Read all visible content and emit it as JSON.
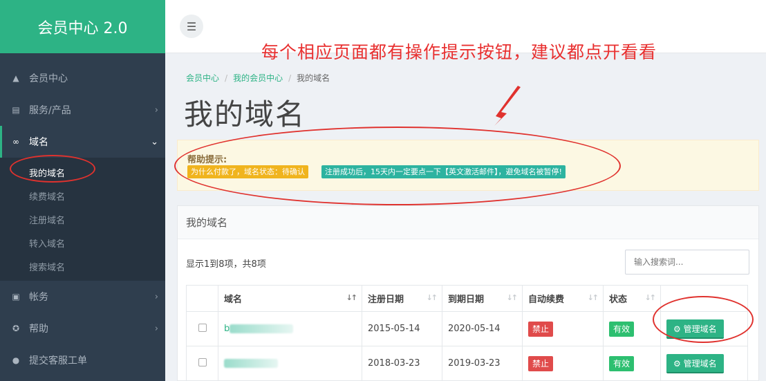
{
  "brand": "会员中心 2.0",
  "annotation": "每个相应页面都有操作提示按钮，建议都点开看看",
  "nav": {
    "items": [
      {
        "label": "会员中心",
        "icon": "home-icon",
        "glyph": "▲"
      },
      {
        "label": "服务/产品",
        "icon": "services-icon",
        "glyph": "▤",
        "chevron": "›"
      },
      {
        "label": "域名",
        "icon": "link-icon",
        "glyph": "∞",
        "chevron": "⌄"
      }
    ],
    "sub_items": [
      "我的域名",
      "续费域名",
      "注册域名",
      "转入域名",
      "搜索域名"
    ],
    "items_after": [
      {
        "label": "帐务",
        "icon": "billing-icon",
        "glyph": "▣",
        "chevron": "›"
      },
      {
        "label": "帮助",
        "icon": "help-icon",
        "glyph": "✪",
        "chevron": "›"
      },
      {
        "label": "提交客服工单",
        "icon": "comment-icon",
        "glyph": "●"
      }
    ]
  },
  "topbar": {
    "menu_icon": "☰"
  },
  "breadcrumb": {
    "home": "会员中心",
    "parent": "我的会员中心",
    "current": "我的域名"
  },
  "page_title": "我的域名",
  "help": {
    "title": "帮助提示:",
    "tag_warning": "为什么付款了，域名状态：待确认",
    "tag_info": "注册成功后，15天内一定要点一下【英文激活邮件】，避免域名被暂停!"
  },
  "card": {
    "header": "我的域名",
    "showing": "显示1到8项，共8项",
    "search_placeholder": "输入搜索词..."
  },
  "table": {
    "columns": [
      "域名",
      "注册日期",
      "到期日期",
      "自动续费",
      "状态"
    ],
    "sort_glyph": "↓↑",
    "rows": [
      {
        "domain_prefix": "b",
        "reg_date": "2015-05-14",
        "exp_date": "2020-05-14",
        "auto_renew": "禁止",
        "status": "有效",
        "action": "⚙ 管理域名"
      },
      {
        "domain_prefix": "",
        "reg_date": "2018-03-23",
        "exp_date": "2019-03-23",
        "auto_renew": "禁止",
        "status": "有效",
        "action": "⚙ 管理域名"
      }
    ]
  },
  "colors": {
    "accent": "#2db385",
    "sidebar": "#2f3e4e",
    "annotation": "#e0322e",
    "warning": "#f0b41e",
    "danger": "#e04b4b",
    "success": "#2dbf70"
  }
}
